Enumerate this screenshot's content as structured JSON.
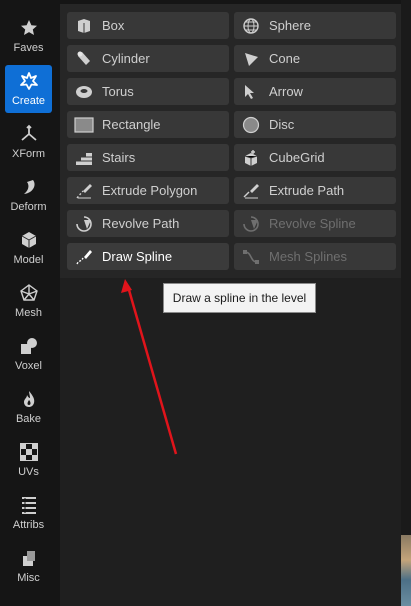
{
  "sidebar": {
    "items": [
      {
        "label": "Faves",
        "icon": "star-icon"
      },
      {
        "label": "Create",
        "icon": "create-sparkle-icon",
        "active": true
      },
      {
        "label": "XForm",
        "icon": "transform-axes-icon"
      },
      {
        "label": "Deform",
        "icon": "deform-icon"
      },
      {
        "label": "Model",
        "icon": "model-cube-icon"
      },
      {
        "label": "Mesh",
        "icon": "mesh-icon"
      },
      {
        "label": "Voxel",
        "icon": "voxel-icon"
      },
      {
        "label": "Bake",
        "icon": "flame-icon"
      },
      {
        "label": "UVs",
        "icon": "checker-icon"
      },
      {
        "label": "Attribs",
        "icon": "list-icon"
      },
      {
        "label": "Misc",
        "icon": "misc-icon"
      }
    ]
  },
  "tools": {
    "box": "Box",
    "sphere": "Sphere",
    "cylinder": "Cylinder",
    "cone": "Cone",
    "torus": "Torus",
    "arrow": "Arrow",
    "rectangle": "Rectangle",
    "disc": "Disc",
    "stairs": "Stairs",
    "cubegrid": "CubeGrid",
    "extrude_polygon": "Extrude Polygon",
    "extrude_path": "Extrude Path",
    "revolve_path": "Revolve Path",
    "revolve_spline": "Revolve Spline",
    "draw_spline": "Draw Spline",
    "mesh_splines": "Mesh Splines"
  },
  "tooltip": {
    "text": "Draw a spline in the level"
  },
  "colors": {
    "accent": "#0f6fd6",
    "annotation_arrow": "#e0141b"
  }
}
